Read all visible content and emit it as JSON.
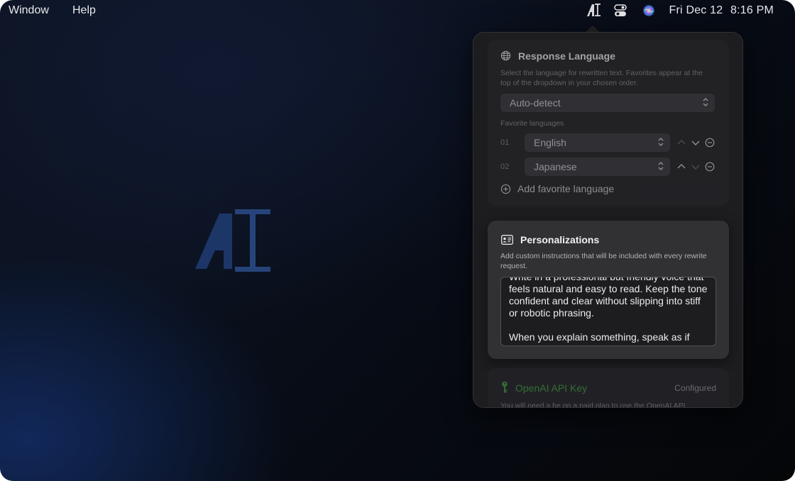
{
  "menubar": {
    "items": [
      "Window",
      "Help"
    ],
    "clock": {
      "day": "Fri Dec 12",
      "time": "8:16 PM"
    },
    "status_icons": [
      "app-logo-icon",
      "control-center-icon",
      "siri-icon"
    ]
  },
  "popover": {
    "response_language": {
      "title": "Response Language",
      "description": "Select the language for rewritten text. Favorites appear at the top of the dropdown in your chosen order.",
      "selected": "Auto-detect",
      "favorites_label": "Favorite languages",
      "favorites": [
        {
          "num": "01",
          "language": "English"
        },
        {
          "num": "02",
          "language": "Japanese"
        }
      ],
      "add_label": "Add favorite language"
    },
    "personalizations": {
      "title": "Personalizations",
      "description": "Add custom instructions that will be included with every rewrite request.",
      "text": "Write in a professional but friendly voice that feels natural and easy to read. Keep the tone confident and clear without slipping into stiff or robotic phrasing.\n\nWhen you explain something, speak as if"
    },
    "api_key": {
      "title": "OpenAI API Key",
      "status": "Configured",
      "description": "You will need a be on a paid plan to use the OpenAI API."
    }
  },
  "colors": {
    "accent_green": "#3f8f3f",
    "logo_blue": "#1f3a70"
  }
}
